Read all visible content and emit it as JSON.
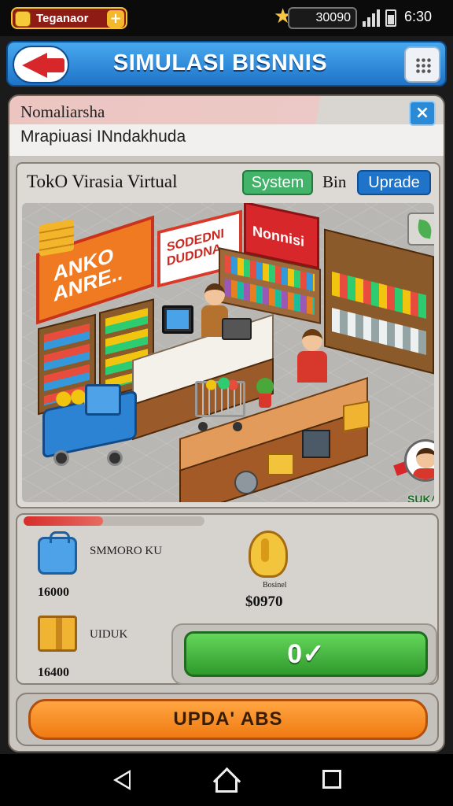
{
  "status_bar": {
    "player_name": "Teganaor",
    "plus_label": "+",
    "currency_amount": "30090",
    "time": "6:30"
  },
  "header": {
    "title": "SIMULASI BISNNIS"
  },
  "panel": {
    "title": "Nomaliarsha",
    "subtitle": "Mrapiuasi INndakhuda",
    "close_label": "×"
  },
  "store": {
    "name": "TokO Virasia Virtual",
    "system_label": "System",
    "bin_label": "Bin",
    "upgrade_label": "Uprade",
    "sign_left": "ANKO ANRE..",
    "sign_middle": "SODEDNI DUDDNA",
    "sign_right": "Nonnisi",
    "character_label": "SUKA"
  },
  "stats": {
    "progress": 0.44,
    "item1": {
      "icon": "shopping-bag-icon",
      "label": "SMMORO KU",
      "value": "16000"
    },
    "item2": {
      "icon": "banana-icon",
      "label": "Bosinel",
      "value": "$0970"
    },
    "item3": {
      "icon": "box-icon",
      "label": "UIDUK",
      "value": "16400"
    },
    "confirm_label": "0✓"
  },
  "footer": {
    "upgrade_label": "UPDA' ABS"
  },
  "colors": {
    "title_bar": "#2f8ad9",
    "confirm_green": "#3fb23a",
    "upgrade_orange": "#f68a1f",
    "progress_red": "#d72d2b"
  }
}
